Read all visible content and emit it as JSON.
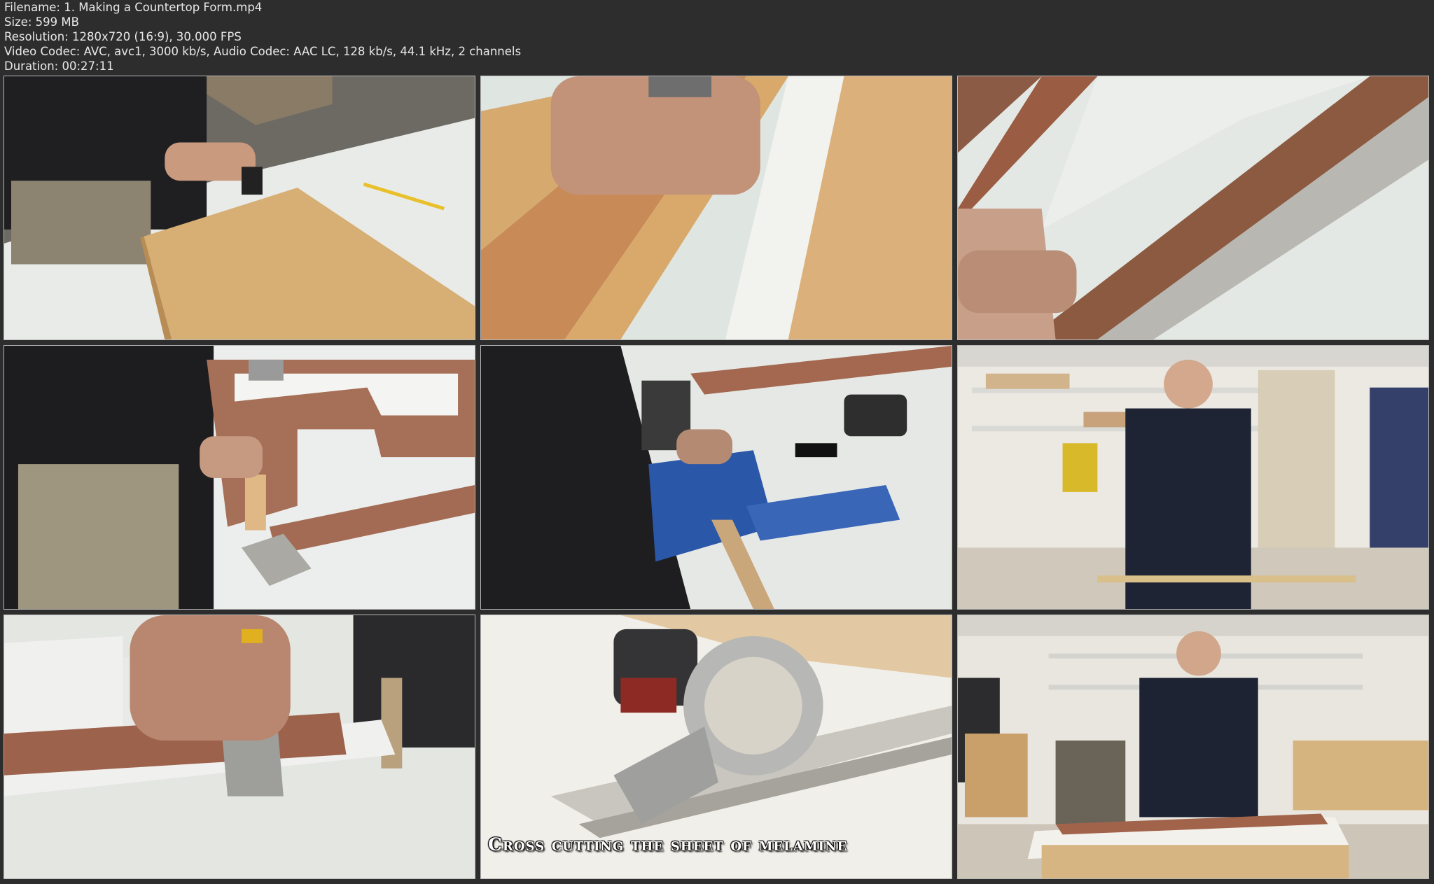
{
  "meta": {
    "filename": "Filename: 1. Making a Countertop Form.mp4",
    "size": "Size: 599 MB",
    "resolution": "Resolution: 1280x720 (16:9), 30.000 FPS",
    "codec": "Video Codec: AVC, avc1, 3000 kb/s, Audio Codec: AAC LC, 128 kb/s, 44.1 kHz, 2 channels",
    "duration": "Duration: 00:27:11"
  },
  "frames": [
    {
      "scene": "hammering-plywood"
    },
    {
      "scene": "plywood-strips-hands"
    },
    {
      "scene": "square-on-frame"
    },
    {
      "scene": "hands-on-frame-corner"
    },
    {
      "scene": "drill-pocket-jig"
    },
    {
      "scene": "presenter-workshop-shelves"
    },
    {
      "scene": "bracket-on-edge"
    },
    {
      "scene": "circular-saw-melamine",
      "caption": "Cross cutting the sheet of melamine"
    },
    {
      "scene": "presenter-with-drills"
    }
  ],
  "colors": {
    "background": "#2d2d2d",
    "metaText": "#e8e8e8",
    "thumbBorder": "#b8b8b8"
  }
}
